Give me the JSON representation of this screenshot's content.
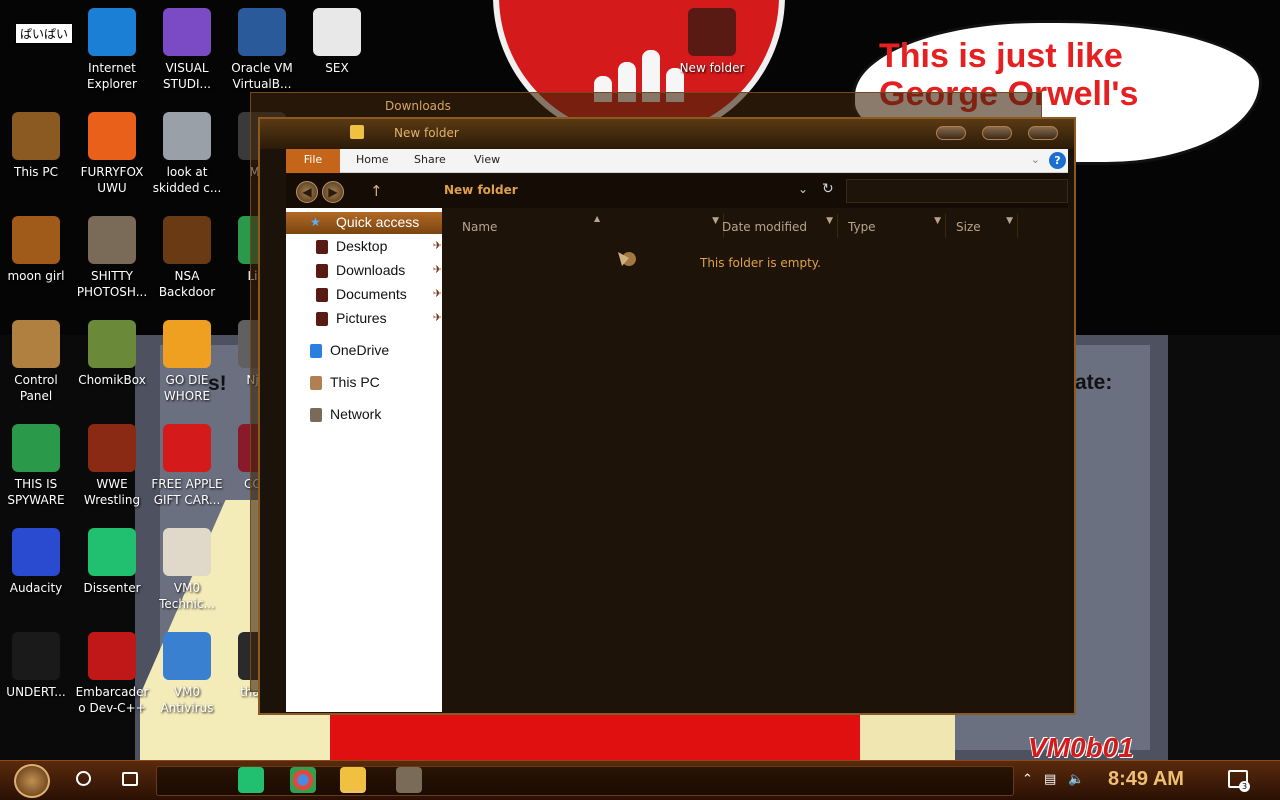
{
  "desktop": {
    "name_tag": "ぱいぱい",
    "speech_bubble": "This is just like George Orwell's",
    "watermark": "VM0b01",
    "behind_text_left": "s!",
    "behind_text_right": "ate:",
    "icons": [
      {
        "label": "Internet Explorer",
        "icon": "browser-icon",
        "color": "#1b7fd6"
      },
      {
        "label": "VISUAL STUDI...",
        "icon": "visual-studio-icon",
        "color": "#7a4bc4"
      },
      {
        "label": "Oracle VM VirtualB...",
        "icon": "virtualbox-icon",
        "color": "#2a5a9a"
      },
      {
        "label": "SEX",
        "icon": "xd-icon",
        "color": "#e8e8e8"
      },
      {
        "label": "New folder",
        "icon": "folder-icon",
        "color": "#5a1a14"
      },
      {
        "label": "This PC",
        "icon": "computer-icon",
        "color": "#8a5a22"
      },
      {
        "label": "FURRYFOX UWU",
        "icon": "firefox-icon",
        "color": "#e8601a"
      },
      {
        "label": "look at skidded c...",
        "icon": "files-icon",
        "color": "#9aa0a8"
      },
      {
        "label": "moon girl",
        "icon": "box-icon",
        "color": "#a05a1a"
      },
      {
        "label": "SHITTY PHOTOSH...",
        "icon": "gimp-icon",
        "color": "#7a6a58"
      },
      {
        "label": "NSA Backdoor",
        "icon": "safe-icon",
        "color": "#6a3a14"
      },
      {
        "label": "Control Panel",
        "icon": "lightbulb-icon",
        "color": "#b08040"
      },
      {
        "label": "ChomikBox",
        "icon": "hamster-icon",
        "color": "#6a8a3a"
      },
      {
        "label": "GO DIE WHORE",
        "icon": "de-icon",
        "color": "#f0a020"
      },
      {
        "label": "THIS IS SPYWARE",
        "icon": "chrome-icon",
        "color": "#2a9a4a"
      },
      {
        "label": "WWE Wrestling",
        "icon": "cabinet-icon",
        "color": "#8a2a14"
      },
      {
        "label": "FREE APPLE GIFT CAR...",
        "icon": "apple-icon",
        "color": "#d41a1a"
      },
      {
        "label": "Audacity",
        "icon": "audacity-icon",
        "color": "#2a4ad0"
      },
      {
        "label": "Dissenter",
        "icon": "chat-icon",
        "color": "#20c070"
      },
      {
        "label": "VM0 Technic...",
        "icon": "technician-icon",
        "color": "#e0d8c8"
      },
      {
        "label": "UNDERT...",
        "icon": "unity-icon",
        "color": "#1a1a1a"
      },
      {
        "label": "Embarcadero Dev-C++",
        "icon": "devcpp-icon",
        "color": "#c01818"
      },
      {
        "label": "VM0 Antivirus",
        "icon": "shield-icon",
        "color": "#3a80d0"
      },
      {
        "label": "Lin...",
        "icon": "partial-icon",
        "color": "#2a9a4a"
      },
      {
        "label": "Nje...",
        "icon": "partial-icon",
        "color": "#606060"
      },
      {
        "label": "COL...",
        "icon": "partial-icon",
        "color": "#8a1a2a"
      },
      {
        "label": "Mi...",
        "icon": "partial-icon",
        "color": "#3a3a3a"
      },
      {
        "label": "that bit",
        "icon": "partial-icon",
        "color": "#2a2a2a"
      }
    ]
  },
  "explorer": {
    "back_title": "Downloads",
    "title": "New folder",
    "ribbon": {
      "file": "File",
      "home": "Home",
      "share": "Share",
      "view": "View",
      "help": "?"
    },
    "address": "New folder",
    "nav": [
      {
        "label": "Quick access",
        "kind": "qa"
      },
      {
        "label": "Desktop",
        "kind": "pinned"
      },
      {
        "label": "Downloads",
        "kind": "pinned"
      },
      {
        "label": "Documents",
        "kind": "pinned"
      },
      {
        "label": "Pictures",
        "kind": "pinned"
      },
      {
        "label": "OneDrive",
        "kind": "top"
      },
      {
        "label": "This PC",
        "kind": "top"
      },
      {
        "label": "Network",
        "kind": "top"
      }
    ],
    "columns": [
      "Name",
      "Date modified",
      "Type",
      "Size"
    ],
    "empty_message": "This folder is empty."
  },
  "taskbar": {
    "time": "8:49 AM",
    "notification_count": "3"
  },
  "colors": {
    "accent": "#c4651a",
    "address_text": "#e0a04a",
    "clock": "#f0c070"
  }
}
